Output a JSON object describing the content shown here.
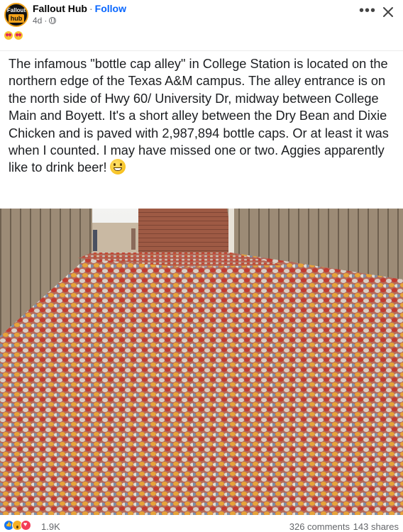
{
  "post": {
    "page_name": "Fallout Hub",
    "follow_label": "Follow",
    "time": "4d",
    "avatar_text": "Fallout",
    "avatar_badge": "hub",
    "privacy_icon": "globe-icon",
    "caption": "The infamous \"bottle cap alley\" in College Station is located on the northern edge of the Texas A&M campus. The alley entrance is on the north side of Hwy 60/ University Dr, midway between College Main and Boyett. It's a short alley between the Dry Bean and Dixie Chicken and is paved with 2,987,894 bottle caps. Or at least it was when I counted. I may have missed one or two. Aggies apparently like to drink beer!"
  },
  "footer": {
    "reaction_count": "1.9K",
    "comments": "326 comments",
    "shares": "143 shares"
  },
  "colors": {
    "accent": "#0866ff",
    "muted": "#65676b"
  }
}
